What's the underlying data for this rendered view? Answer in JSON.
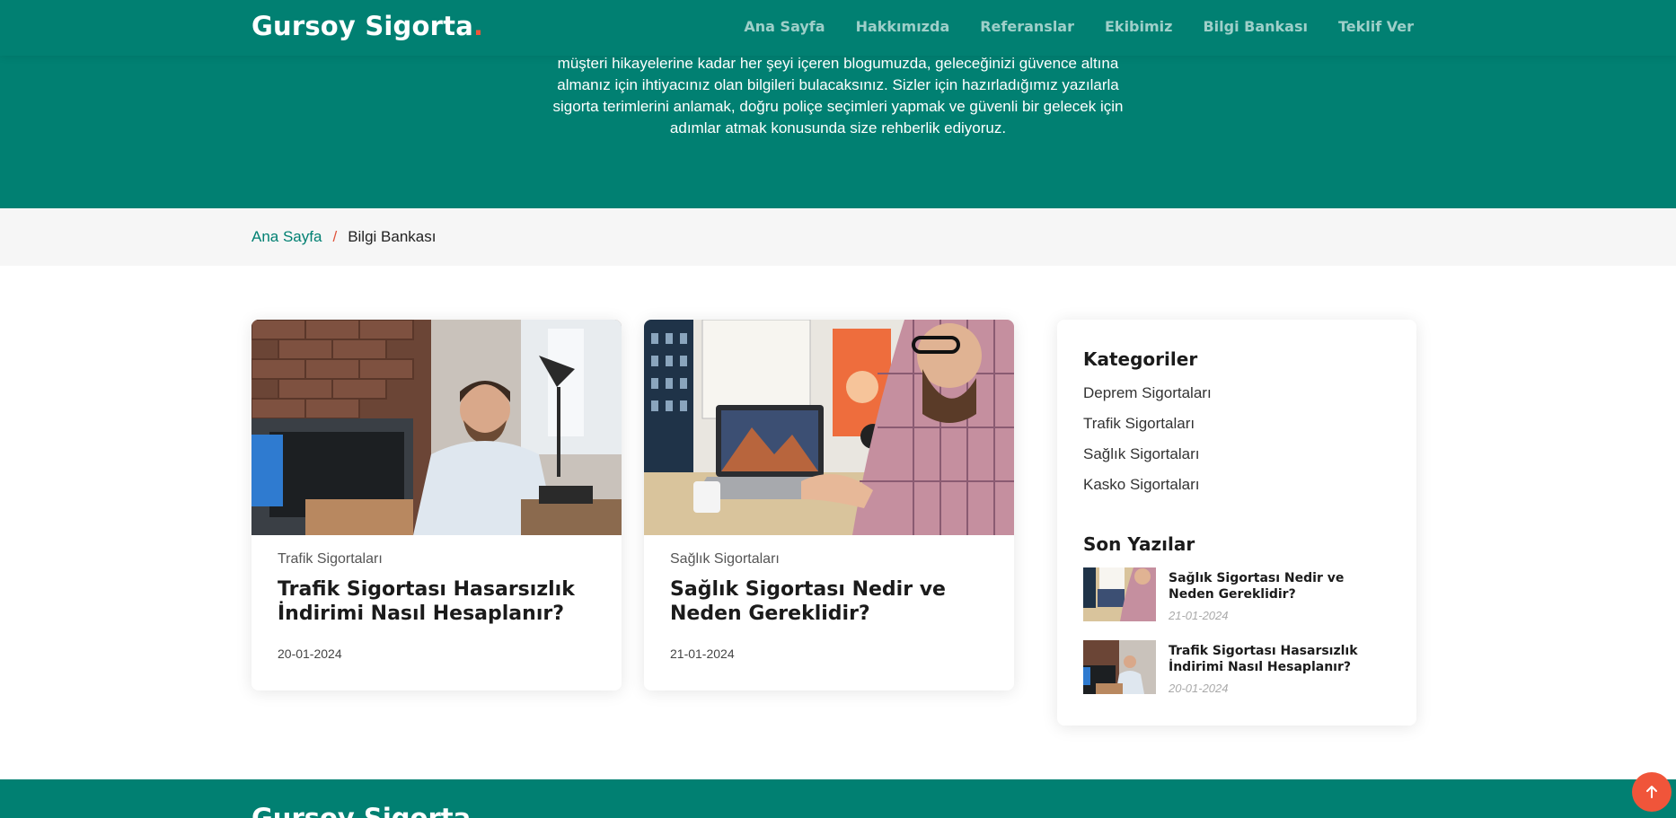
{
  "brand": {
    "name": "Gursoy Sigorta",
    "dot": ".",
    "accent_color": "#f0553a",
    "primary_color": "#018072"
  },
  "nav": {
    "items": [
      {
        "label": "Ana Sayfa"
      },
      {
        "label": "Hakkımızda"
      },
      {
        "label": "Referanslar"
      },
      {
        "label": "Ekibimiz"
      },
      {
        "label": "Bilgi Bankası"
      },
      {
        "label": "Teklif Ver"
      }
    ]
  },
  "hero": {
    "lines": [
      "müşteri hikayelerine kadar her şeyi içeren blogumuzda, geleceğinizi güvence altına",
      "almanız için ihtiyacınız olan bilgileri bulacaksınız. Sizler için hazırladığımız yazılarla",
      "sigorta terimlerini anlamak, doğru poliçe seçimleri yapmak ve güvenli bir gelecek için",
      "adımlar atmak konusunda size rehberlik ediyoruz."
    ]
  },
  "breadcrumb": {
    "home": "Ana Sayfa",
    "separator": "/",
    "current": "Bilgi Bankası"
  },
  "posts": [
    {
      "category": "Trafik Sigortaları",
      "title": "Trafik Sigortası Hasarsızlık İndirimi Nasıl Hesaplanır?",
      "date": "20-01-2024"
    },
    {
      "category": "Sağlık Sigortaları",
      "title": "Sağlık Sigortası Nedir ve Neden Gereklidir?",
      "date": "21-01-2024"
    }
  ],
  "sidebar": {
    "categories_heading": "Kategoriler",
    "categories": [
      "Deprem Sigortaları",
      "Trafik Sigortaları",
      "Sağlık Sigortaları",
      "Kasko Sigortaları"
    ],
    "recent_heading": "Son Yazılar",
    "recent": [
      {
        "title": "Sağlık Sigortası Nedir ve Neden Gereklidir?",
        "date": "21-01-2024"
      },
      {
        "title": "Trafik Sigortası Hasarsızlık İndirimi Nasıl Hesaplanır?",
        "date": "20-01-2024"
      }
    ]
  },
  "footer": {
    "brand": "Gursoy Sigorta"
  },
  "icons": {
    "scroll_top": "arrow-up-icon"
  }
}
